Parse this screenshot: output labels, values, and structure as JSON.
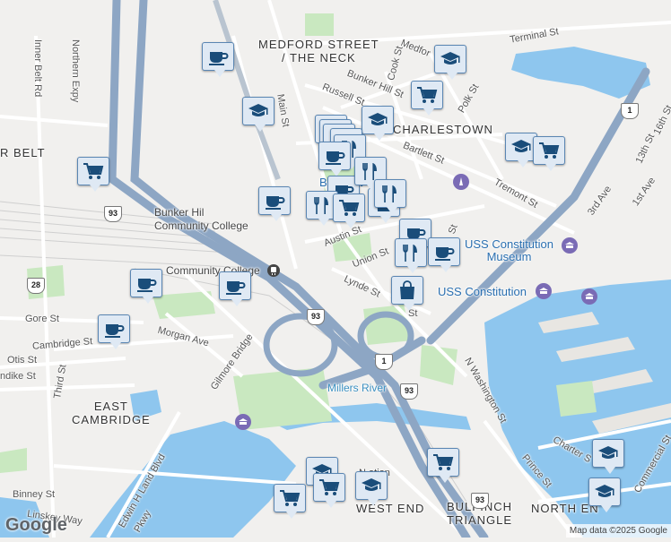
{
  "map": {
    "attribution": "Map data ©2025 Google",
    "logo": "Google",
    "colors": {
      "land": "#f1f0ee",
      "water": "#8ec6ee",
      "park": "#c9e8c0",
      "highway": "#8da6c4",
      "road": "#ffffff",
      "marker_fill": "#dfe9f4",
      "marker_border": "#5a86b3",
      "marker_icon": "#1a4d7a"
    }
  },
  "labels": {
    "areas": {
      "medford_neck": "MEDFORD STREET\n/ THE NECK",
      "charlestown": "CHARLESTOWN",
      "inner_belt": "R BELT",
      "east_cambridge": "EAST\nCAMBRIDGE",
      "west_end": "WEST END",
      "bulfinch": "BULFINCH\nTRIANGLE",
      "north_end": "NORTH EN"
    },
    "streets": {
      "northern_expy": "Northern Expy",
      "inner_belt_rd": "Inner Belt Rd",
      "main_st": "Main St",
      "medford": "Medfor",
      "terminal_st": "Terminal St",
      "bunker_hill_st": "Bunker Hill St",
      "russell_st": "Russell St",
      "cook_st": "Cook St",
      "polk_st": "Polk St",
      "bartlett_st": "Bartlett St",
      "tremont_st": "Tremont St",
      "third_ave": "3rd Ave",
      "first_ave": "1st Ave",
      "sixteenth_st": "16th St",
      "thirteenth_st": "13th St",
      "austin_st": "Austin St",
      "union_st": "Union St",
      "lynde_st": "Lynde St",
      "gore_st": "Gore St",
      "cambridge_st": "Cambridge St",
      "morgan_ave": "Morgan Ave",
      "gilmore_bridge": "Gilmore Bridge",
      "otis_st": "Otis St",
      "thorndike_st": "ndike St",
      "third_st": "Third St",
      "edwin_land_blvd": "Edwin H Land Blvd",
      "binney_st": "Binney St",
      "linskey_way": "Linskey Way",
      "pkwy": "Pkwy",
      "n_washington_st": "N Washington St",
      "charter_st": "Charter S",
      "commercial_st": "Commercial St",
      "prince_st": "Prince St",
      "north_station": "N      ation",
      "st_label": "St",
      "chelsea_st": "St"
    },
    "pois": {
      "bunker_hill_cc": "Bunker Hil\nCommunity College",
      "community_college_station": "Community College",
      "bunker_hill_monument": "B         ument",
      "uss_constitution_museum": "USS Constitution\nMuseum",
      "uss_constitution": "USS Constitution",
      "millers_river": "Millers River"
    },
    "shields": [
      "93",
      "93",
      "1",
      "93",
      "1",
      "28",
      "93"
    ]
  },
  "markers": [
    {
      "icon": "coffee-icon"
    },
    {
      "icon": "school-icon"
    },
    {
      "icon": "school-icon"
    },
    {
      "icon": "shopping-cart-icon"
    },
    {
      "icon": "school-icon"
    },
    {
      "icon": "school-icon"
    },
    {
      "icon": "shopping-cart-icon"
    },
    {
      "icon": "shopping-cart-icon"
    },
    {
      "icon": "restaurant-icon"
    },
    {
      "icon": "restaurant-icon"
    },
    {
      "icon": "restaurant-icon"
    },
    {
      "icon": "restaurant-icon"
    },
    {
      "icon": "restaurant-icon"
    },
    {
      "icon": "coffee-icon"
    },
    {
      "icon": "coffee-icon"
    },
    {
      "icon": "shopping-bag-icon"
    },
    {
      "icon": "restaurant-icon"
    },
    {
      "icon": "shopping-cart-icon"
    },
    {
      "icon": "restaurant-icon"
    },
    {
      "icon": "restaurant-icon"
    },
    {
      "icon": "coffee-icon"
    },
    {
      "icon": "shopping-bag-icon"
    },
    {
      "icon": "coffee-icon"
    },
    {
      "icon": "coffee-icon"
    },
    {
      "icon": "coffee-icon"
    },
    {
      "icon": "coffee-icon"
    },
    {
      "icon": "coffee-icon"
    },
    {
      "icon": "school-icon"
    },
    {
      "icon": "shopping-cart-icon"
    },
    {
      "icon": "shopping-cart-icon"
    },
    {
      "icon": "shopping-cart-icon"
    },
    {
      "icon": "school-icon"
    },
    {
      "icon": "school-icon"
    },
    {
      "icon": "school-icon"
    },
    {
      "icon": "restaurant-icon"
    }
  ]
}
